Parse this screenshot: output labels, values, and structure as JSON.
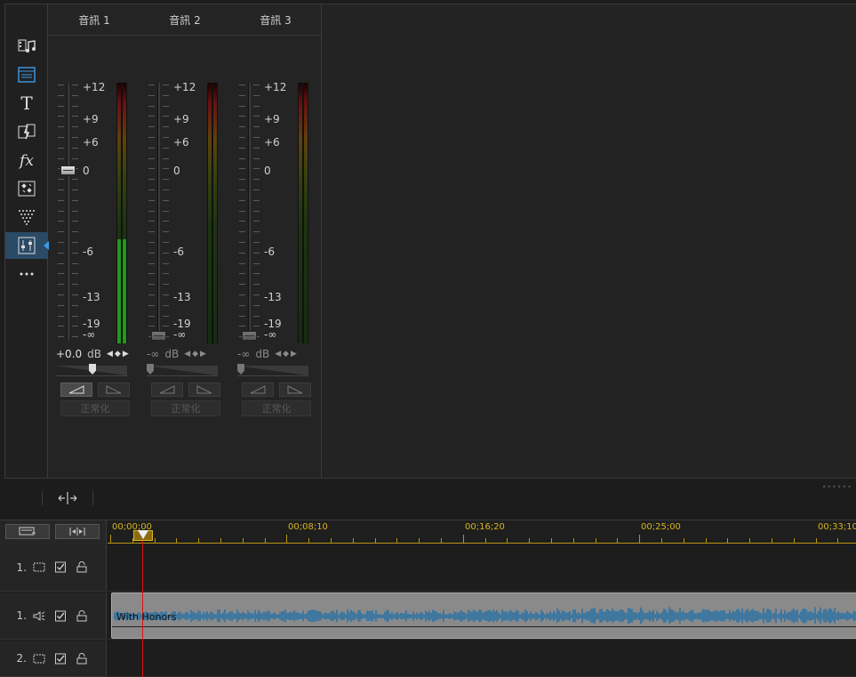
{
  "mixer": {
    "channels": [
      {
        "name": "音訊 1",
        "value": "+0.0",
        "unit": "dB",
        "active": true,
        "pan_position": "center",
        "meter_fill": 0.4
      },
      {
        "name": "音訊 2",
        "value": "-∞",
        "unit": "dB",
        "active": false,
        "pan_position": "left",
        "meter_fill": 0
      },
      {
        "name": "音訊 3",
        "value": "-∞",
        "unit": "dB",
        "active": false,
        "pan_position": "left",
        "meter_fill": 0
      }
    ],
    "scale": [
      "+12",
      "+9",
      "+6",
      "0",
      "-6",
      "-13",
      "-19",
      "-∞"
    ],
    "normalize_label": "正常化"
  },
  "sidebar": {
    "items": [
      {
        "icon": "media-music-icon"
      },
      {
        "icon": "media-room-icon"
      },
      {
        "icon": "title-icon",
        "glyph": "T"
      },
      {
        "icon": "transition-icon"
      },
      {
        "icon": "effects-icon",
        "glyph": "fx"
      },
      {
        "icon": "pip-icon"
      },
      {
        "icon": "particle-icon"
      },
      {
        "icon": "audio-mixer-icon",
        "active": true
      },
      {
        "icon": "more-icon",
        "glyph": "•••"
      }
    ]
  },
  "timeline": {
    "ruler": [
      "00;00;00",
      "00;08;10",
      "00;16;20",
      "00;25;00",
      "00;33;10"
    ],
    "tracks": [
      {
        "num": "1.",
        "type": "video"
      },
      {
        "num": "1.",
        "type": "audio"
      },
      {
        "num": "2.",
        "type": "video"
      }
    ],
    "clip_title": "With Honors"
  },
  "colors": {
    "accent": "#3d9be9",
    "ruler": "#d7b420",
    "playhead": "#dd1111",
    "waveform": "#1f6fa8"
  }
}
